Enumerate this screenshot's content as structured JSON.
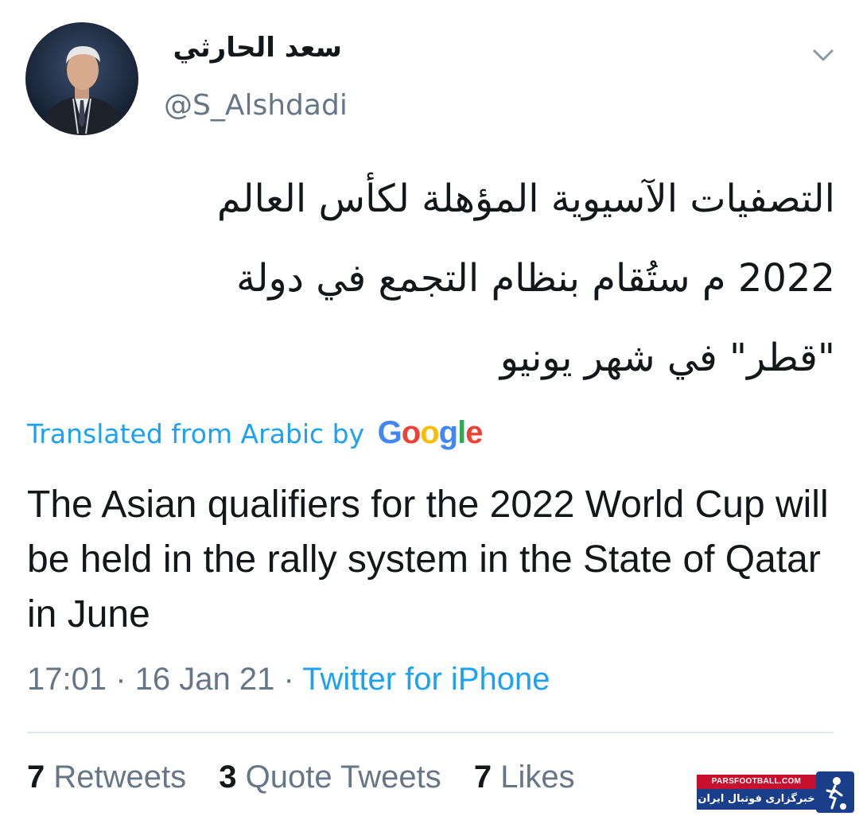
{
  "author": {
    "display_name": "سعد الحارثي",
    "handle": "@S_Alshdadi",
    "avatar": "avatar-photo"
  },
  "menu_icon": "chevron-down-icon",
  "tweet": {
    "arabic_lines": [
      "التصفيات الآسيوية المؤهلة لكأس العالم",
      "2022 م ستُقام بنظام التجمع في دولة",
      "\"قطر\" في شهر يونيو"
    ],
    "translation_note": "Translated from Arabic by",
    "translation_provider": "Google",
    "translated_text": "The Asian qualifiers for the 2022 World Cup will be held in the rally system in the State of Qatar in June"
  },
  "meta": {
    "time": "17:01",
    "separator": "·",
    "date": "16 Jan 21",
    "source": "Twitter for iPhone"
  },
  "stats": {
    "retweets_count": "7",
    "retweets_label": "Retweets",
    "quotes_count": "3",
    "quotes_label": "Quote Tweets",
    "likes_count": "7",
    "likes_label": "Likes"
  },
  "watermark": {
    "site": "PARSFOOTBALL.COM",
    "tagline": "خبرگزاری فوتبال ایران"
  },
  "colors": {
    "link_blue": "#1da1f2",
    "muted_gray": "#657786",
    "text_dark": "#14171a"
  }
}
